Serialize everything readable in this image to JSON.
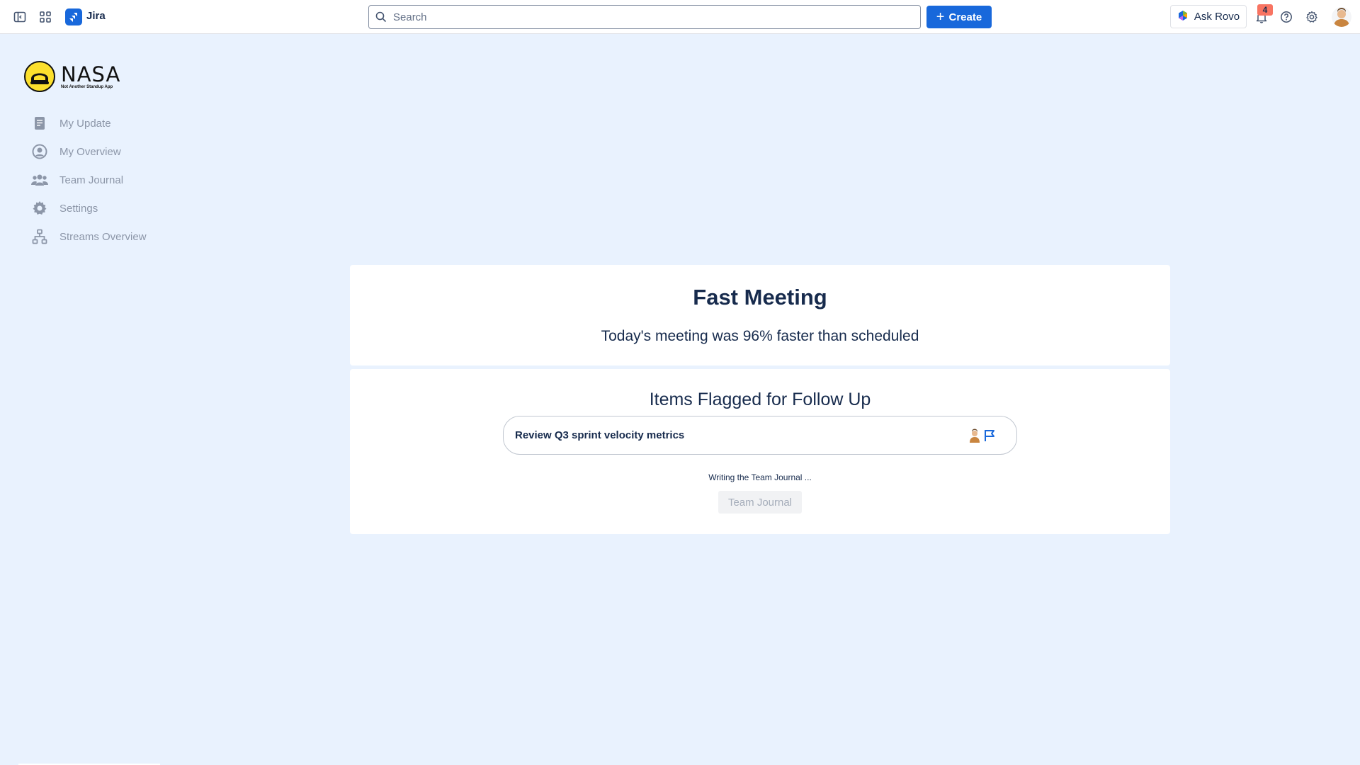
{
  "topbar": {
    "app_name": "Jira",
    "search_placeholder": "Search",
    "create_label": "Create",
    "ask_rovo_label": "Ask Rovo",
    "notification_count": "4"
  },
  "sidebar": {
    "logo_title": "NASA",
    "logo_subtitle": "Not Another Standup App",
    "items": [
      {
        "label": "My Update",
        "icon": "document-icon"
      },
      {
        "label": "My Overview",
        "icon": "user-circle-icon"
      },
      {
        "label": "Team Journal",
        "icon": "team-icon"
      },
      {
        "label": "Settings",
        "icon": "gear-icon"
      },
      {
        "label": "Streams Overview",
        "icon": "hierarchy-icon"
      }
    ]
  },
  "meeting": {
    "title": "Fast Meeting",
    "subtitle": "Today's meeting was 96% faster than scheduled"
  },
  "followup": {
    "title": "Items Flagged for Follow Up",
    "items": [
      {
        "text": "Review Q3 sprint velocity metrics"
      }
    ],
    "status_text": "Writing the Team Journal ...",
    "journal_button": "Team Journal"
  },
  "colors": {
    "accent": "#1868db",
    "background": "#e9f2fe",
    "badge": "#f87462",
    "logo_yellow": "#fce02d"
  }
}
